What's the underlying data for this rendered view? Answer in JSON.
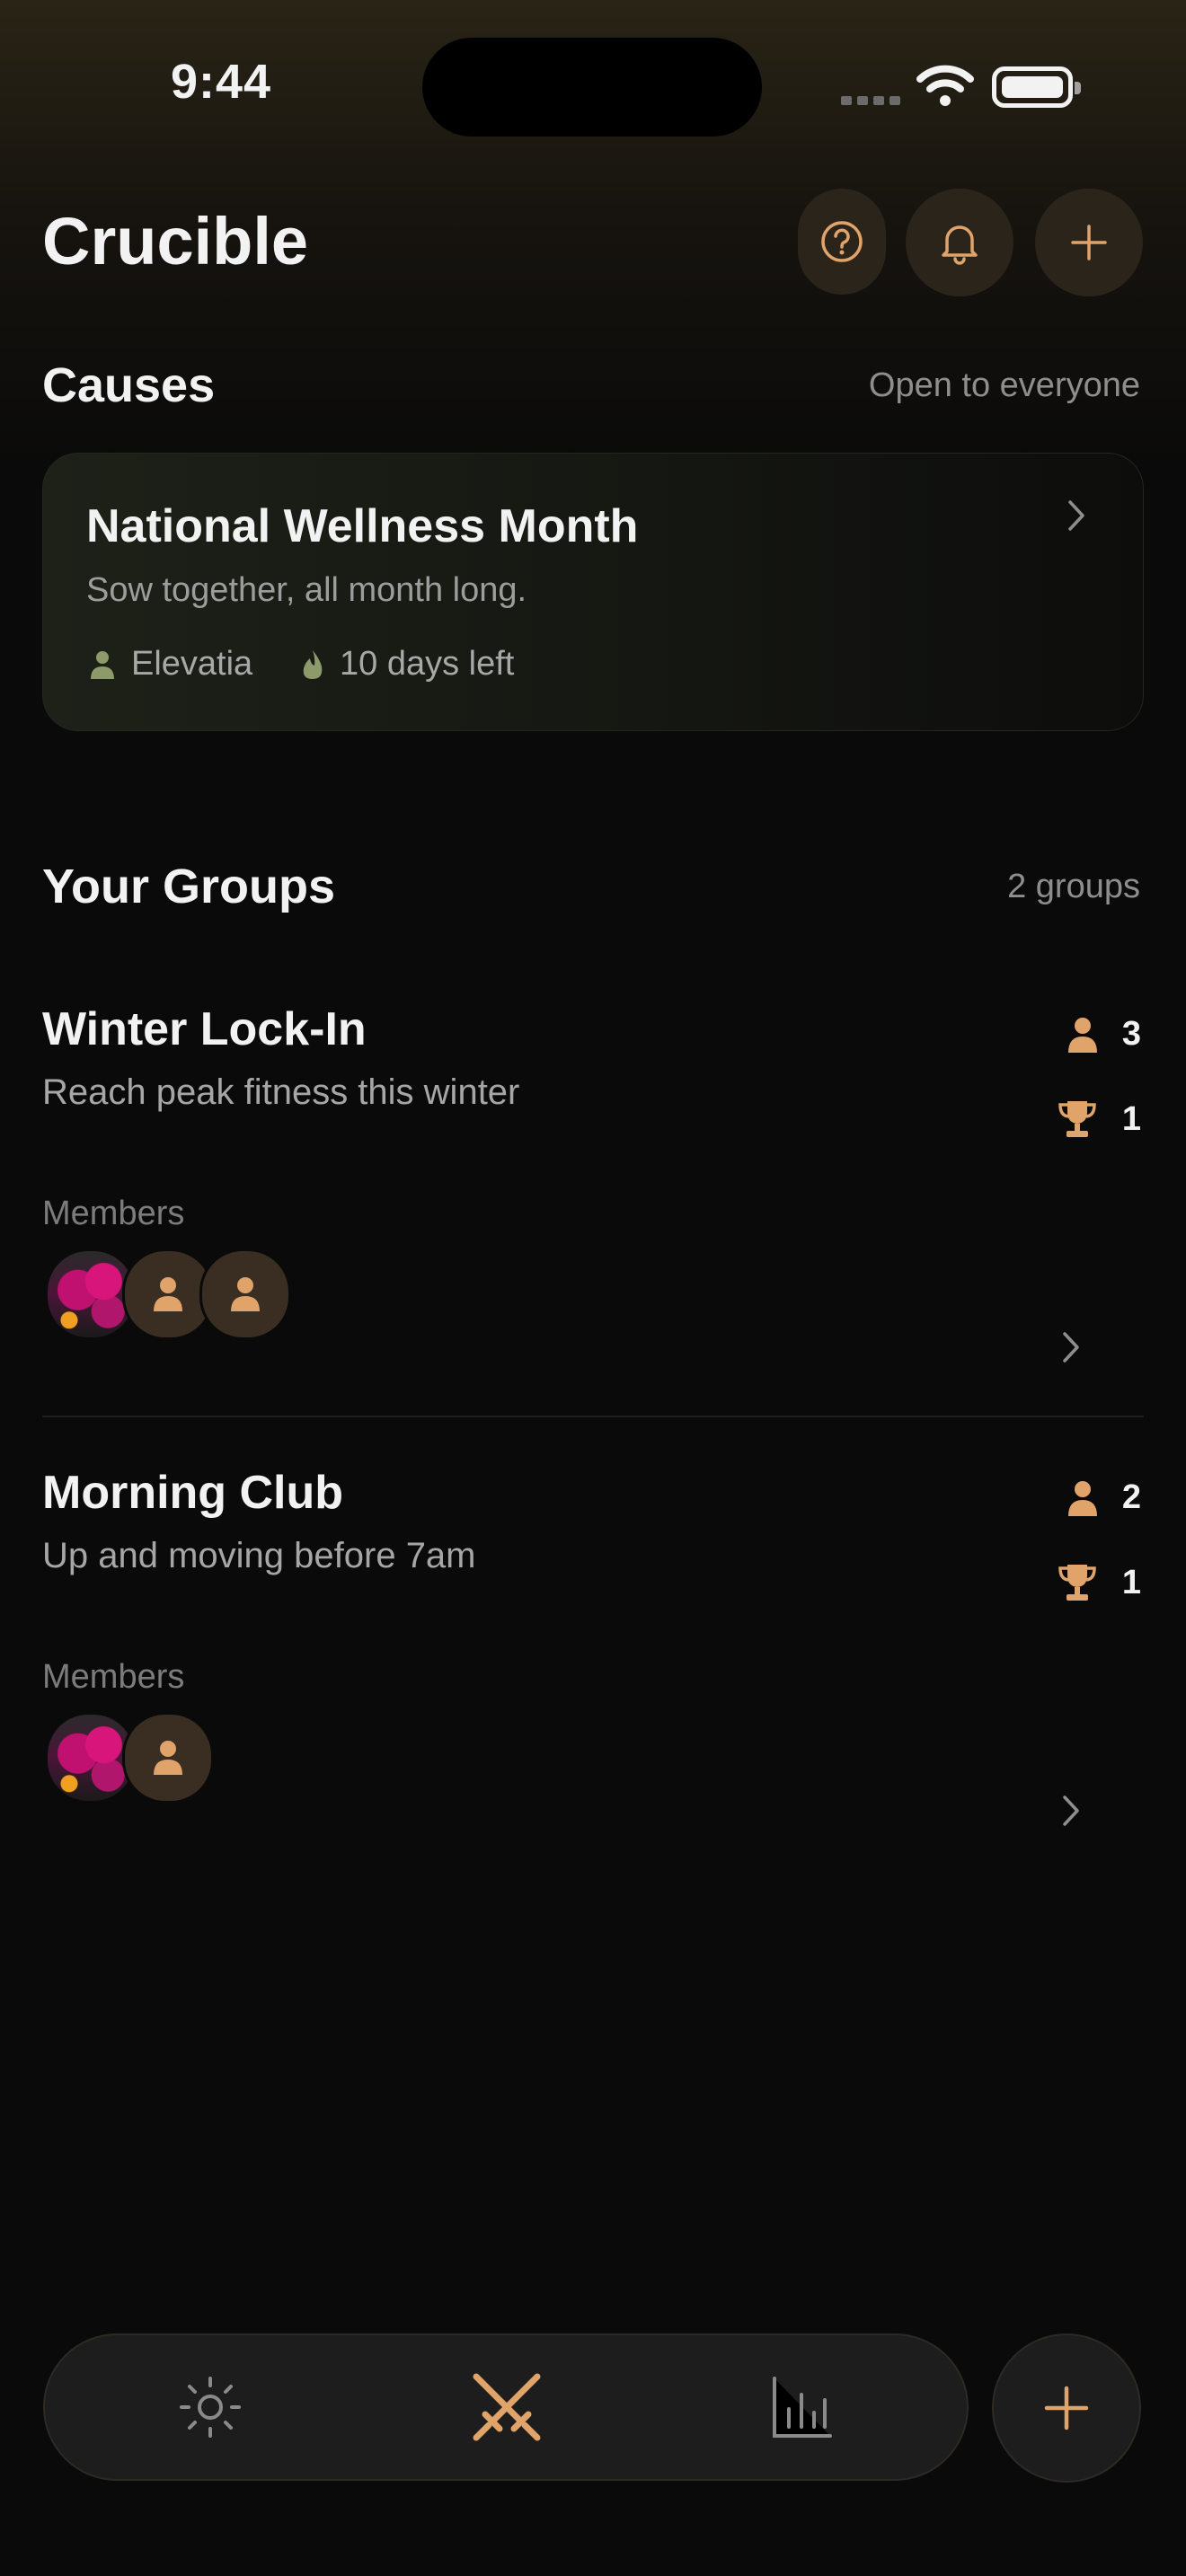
{
  "status_bar": {
    "time": "9:44"
  },
  "header": {
    "title": "Crucible"
  },
  "causes": {
    "title": "Causes",
    "meta": "Open to everyone",
    "card": {
      "title": "National Wellness Month",
      "subtitle": "Sow together, all month long.",
      "organizer": "Elevatia",
      "time_left": "10 days left"
    }
  },
  "groups": {
    "title": "Your Groups",
    "meta": "2 groups",
    "members_label": "Members",
    "items": [
      {
        "name": "Winter Lock-In",
        "description": "Reach peak fitness this winter",
        "member_count": "3",
        "trophy_count": "1"
      },
      {
        "name": "Morning Club",
        "description": "Up and moving before 7am",
        "member_count": "2",
        "trophy_count": "1"
      }
    ]
  },
  "colors": {
    "accent": "#e0a46a",
    "background": "#0a0a0a",
    "cause_green": "#8d9a6a"
  },
  "tab_bar": {
    "tabs": [
      "sun-icon",
      "crossed-swords-icon",
      "bar-chart-icon"
    ],
    "active": "crossed-swords-icon"
  }
}
